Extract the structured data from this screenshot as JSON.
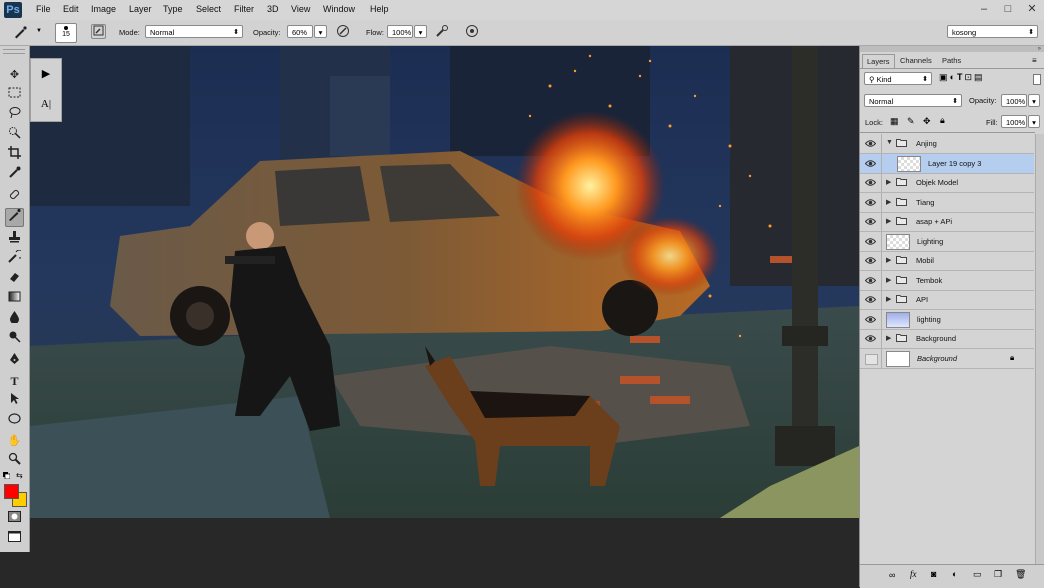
{
  "app": {
    "logo": "Ps"
  },
  "menu": [
    "File",
    "Edit",
    "Image",
    "Layer",
    "Type",
    "Select",
    "Filter",
    "3D",
    "View",
    "Window",
    "Help"
  ],
  "window_controls": {
    "minimize": "–",
    "maximize": "□",
    "close": "✕"
  },
  "options": {
    "brush_size": "15",
    "mode_label": "Mode:",
    "mode_value": "Normal",
    "opacity_label": "Opacity:",
    "opacity_value": "60%",
    "flow_label": "Flow:",
    "flow_value": "100%",
    "workspace": "kosong"
  },
  "panels": {
    "tabs": [
      "Layers",
      "Channels",
      "Paths"
    ],
    "filter_kind": "Kind",
    "blend_mode": "Normal",
    "opacity_label": "Opacity:",
    "opacity_value": "100%",
    "lock_label": "Lock:",
    "fill_label": "Fill:",
    "fill_value": "100%",
    "layers": [
      {
        "name": "Anjing",
        "type": "group",
        "expanded": true,
        "selected": false,
        "visible": true
      },
      {
        "name": "Layer 19 copy 3",
        "type": "layer",
        "indent": true,
        "selected": true,
        "visible": true
      },
      {
        "name": "Objek Model",
        "type": "group",
        "expanded": false,
        "selected": false,
        "visible": true
      },
      {
        "name": "Tiang",
        "type": "group",
        "expanded": false,
        "selected": false,
        "visible": true
      },
      {
        "name": "asap + APi",
        "type": "group",
        "expanded": false,
        "selected": false,
        "visible": true
      },
      {
        "name": "Lighting",
        "type": "layer",
        "selected": false,
        "visible": true
      },
      {
        "name": "Mobil",
        "type": "group",
        "expanded": false,
        "selected": false,
        "visible": true
      },
      {
        "name": "Tembok",
        "type": "group",
        "expanded": false,
        "selected": false,
        "visible": true
      },
      {
        "name": "API",
        "type": "group",
        "expanded": false,
        "selected": false,
        "visible": true
      },
      {
        "name": "lighting",
        "type": "layer",
        "selected": false,
        "visible": true
      },
      {
        "name": "Background",
        "type": "group",
        "expanded": false,
        "selected": false,
        "visible": true
      },
      {
        "name": "Background",
        "type": "background",
        "selected": false,
        "visible": false,
        "locked": true
      }
    ]
  },
  "colors": {
    "foreground": "#ff0000",
    "background": "#ffcc00",
    "selection": "#b5cef0"
  }
}
